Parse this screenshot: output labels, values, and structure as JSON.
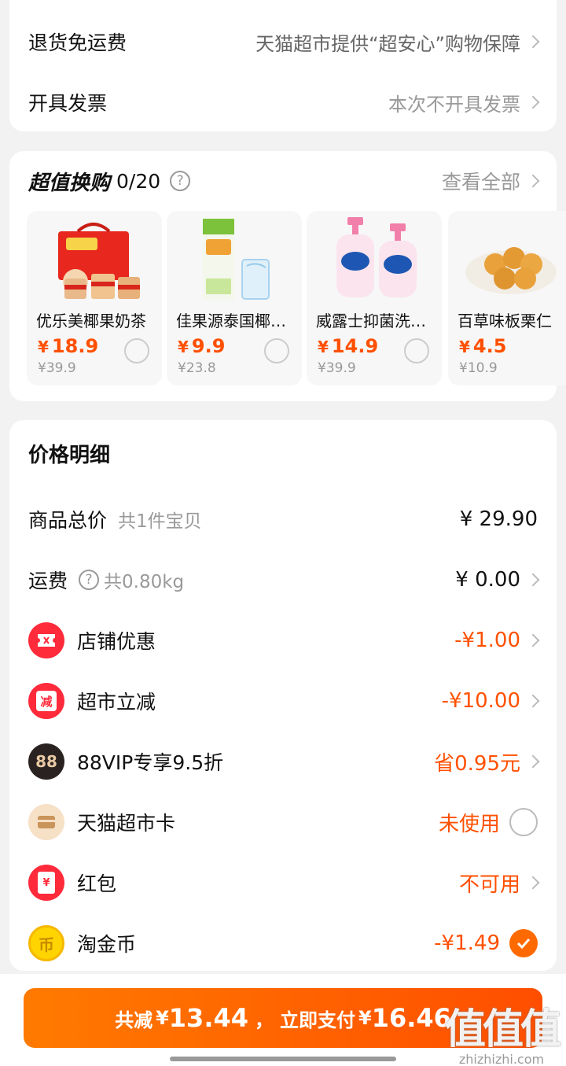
{
  "top_card": {
    "rows": [
      {
        "label": "退货免运费",
        "value": "天猫超市提供“超安心”购物保障"
      },
      {
        "label": "开具发票",
        "value": "本次不开具发票"
      }
    ]
  },
  "swap": {
    "title": "超值换购",
    "count": "0/20",
    "help": "?",
    "view_all": "查看全部",
    "products": [
      {
        "name": "优乐美椰果奶茶",
        "currency": "¥",
        "price": "18.9",
        "orig": "¥39.9"
      },
      {
        "name": "佳果源泰国椰子水",
        "currency": "¥",
        "price": "9.9",
        "orig": "¥23.8"
      },
      {
        "name": "威露士抑菌洗手液",
        "currency": "¥",
        "price": "14.9",
        "orig": "¥39.9"
      },
      {
        "name": "百草味板栗仁",
        "currency": "¥",
        "price": "4.5",
        "orig": "¥10.9"
      }
    ]
  },
  "price_detail": {
    "title": "价格明细",
    "goods_total": {
      "label": "商品总价",
      "sub": "共1件宝贝",
      "amount": "¥ 29.90"
    },
    "shipping": {
      "label": "运费",
      "help": "?",
      "sub": "共0.80kg",
      "amount": "¥ 0.00"
    },
    "shop_discount": {
      "label": "店铺优惠",
      "amount": "-¥1.00"
    },
    "market_discount": {
      "label": "超市立减",
      "icon_text": "减",
      "amount": "-¥10.00"
    },
    "vip": {
      "label": "88VIP专享9.5折",
      "icon_text": "88",
      "amount": "省0.95元"
    },
    "card": {
      "label": "天猫超市卡",
      "amount": "未使用"
    },
    "hongbao": {
      "label": "红包",
      "icon_text": "¥",
      "amount": "不可用"
    },
    "coin": {
      "label": "淘金币",
      "icon_text": "币",
      "amount": "-¥1.49"
    }
  },
  "bottom": {
    "save_prefix": "共减",
    "save_currency": "¥",
    "save_amount": "13.44",
    "sep": "，",
    "pay_prefix": "立即支付",
    "pay_currency": "¥",
    "pay_amount": "16.46",
    "watermark": "值值值",
    "watermark_url": "zhizhizhi.com"
  },
  "colors": {
    "accent": "#ff5000",
    "button": "#ff6a00",
    "background": "#f2f2f2"
  }
}
